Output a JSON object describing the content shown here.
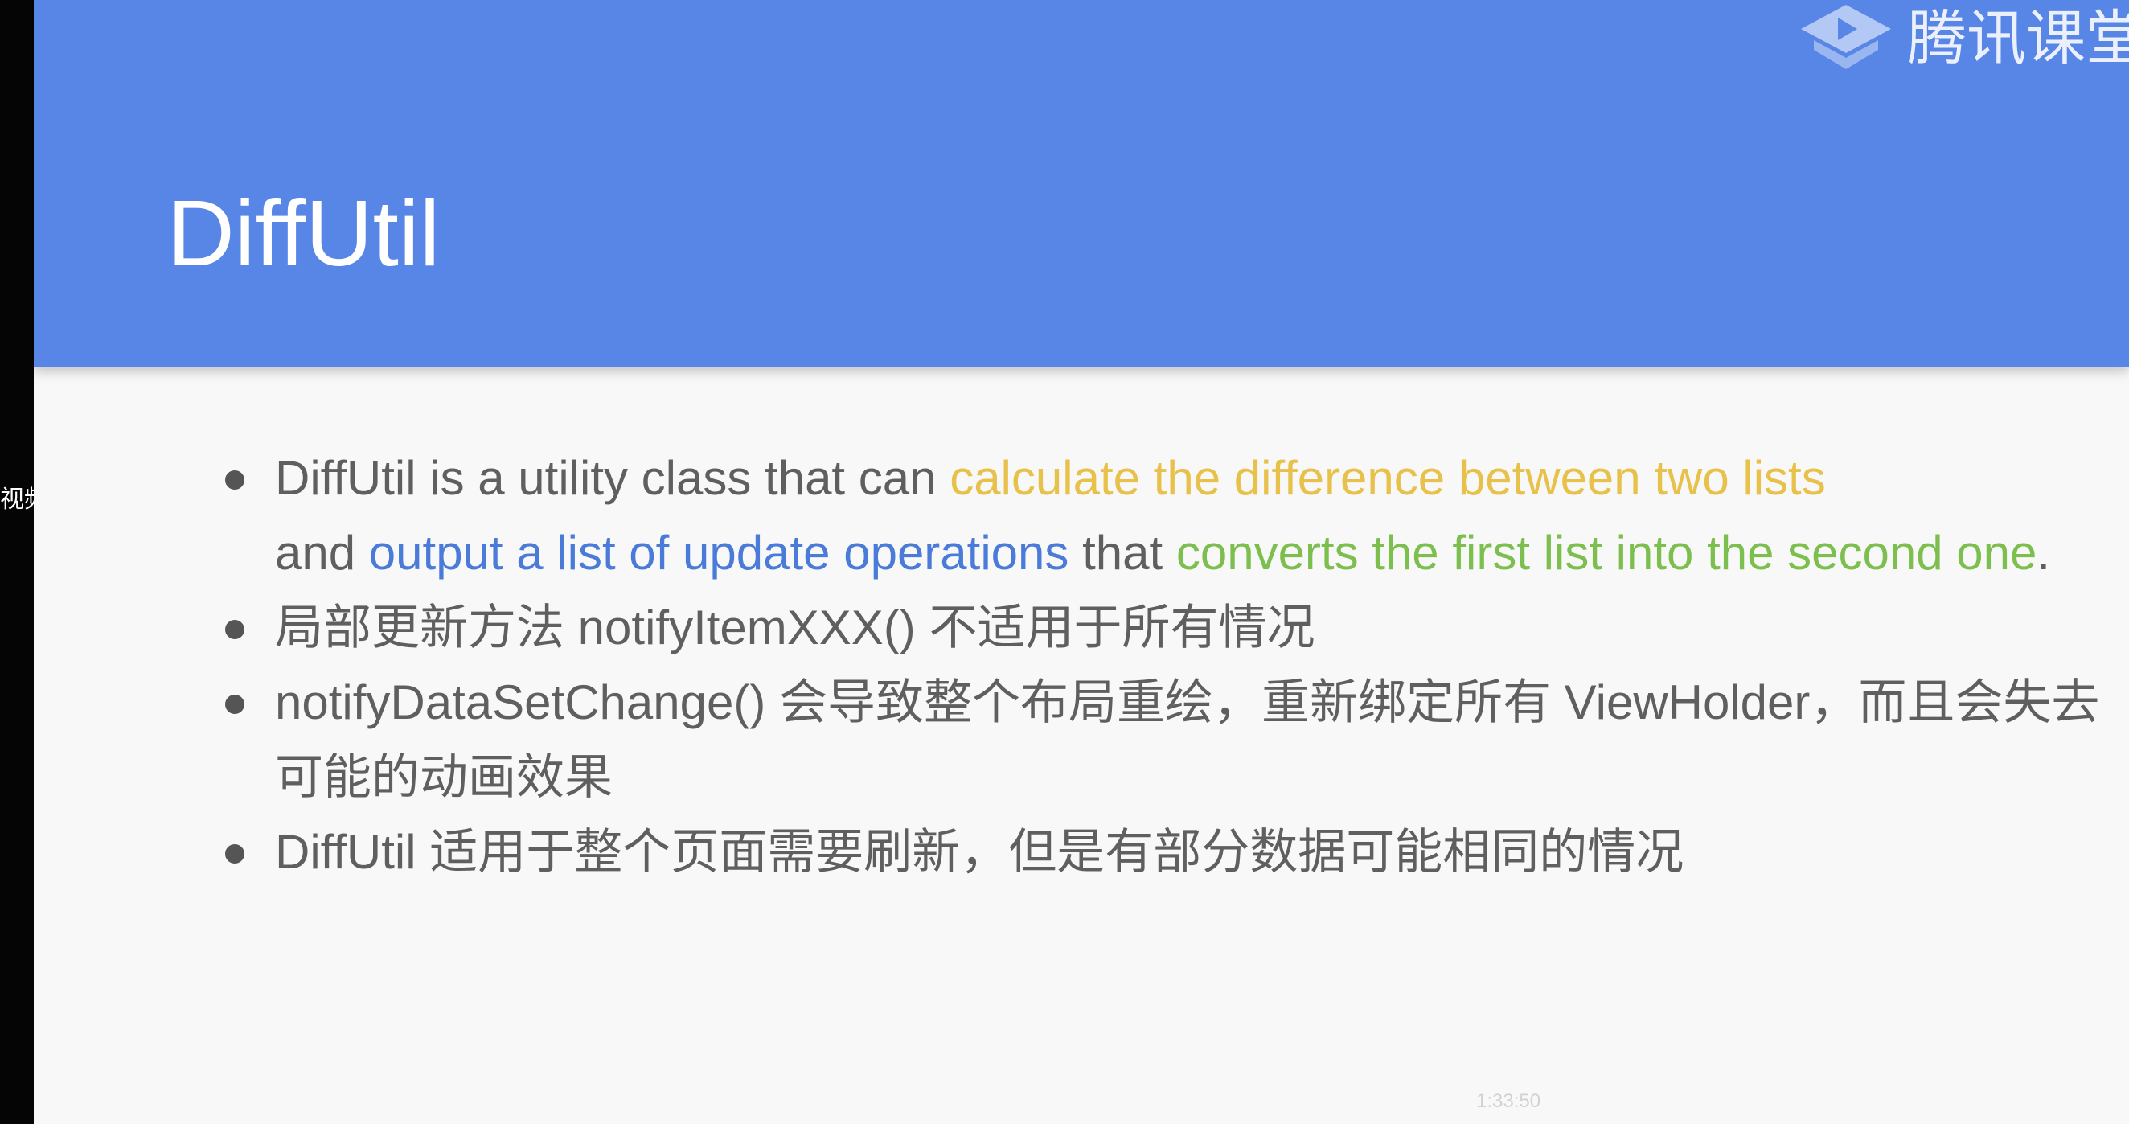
{
  "side_label": "视频",
  "brand": {
    "icon": "tencent-classroom-logo-icon",
    "name": "腾讯课堂"
  },
  "slide": {
    "title": "DiffUtil",
    "bullets": [
      {
        "parts": [
          "DiffUtil is a utility class that can ",
          "calculate the difference between two lists",
          " and ",
          "output a list of update operations",
          " that ",
          "converts the first list into the second one",
          "."
        ]
      },
      {
        "text": "局部更新方法 notifyItemXXX() 不适用于所有情况"
      },
      {
        "text": "notifyDataSetChange() 会导致整个布局重绘，重新绑定所有 ViewHolder，而且会失去可能的动画效果"
      },
      {
        "text": "DiffUtil 适用于整个页面需要刷新，但是有部分数据可能相同的情况"
      }
    ]
  },
  "player": {
    "timestamp": "1:33:50"
  },
  "colors": {
    "header_blue": "#5886e6",
    "highlight_yellow": "#e7c14a",
    "highlight_blue": "#4b7bd9",
    "highlight_green": "#7cbf4f",
    "body_text": "#5f5f5f"
  }
}
